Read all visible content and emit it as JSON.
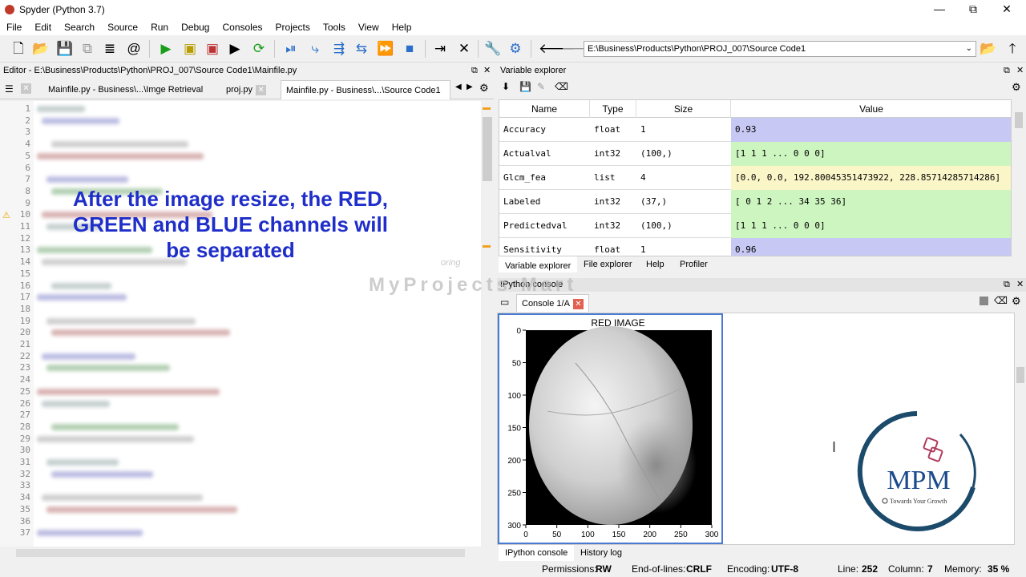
{
  "window": {
    "title": "Spyder (Python 3.7)",
    "minimize": "—",
    "maximize": "⧉",
    "close": "✕"
  },
  "menu": [
    "File",
    "Edit",
    "Search",
    "Source",
    "Run",
    "Debug",
    "Consoles",
    "Projects",
    "Tools",
    "View",
    "Help"
  ],
  "toolbar": {
    "path": "E:\\Business\\Products\\Python\\PROJ_007\\Source Code1"
  },
  "editor": {
    "title": "Editor - E:\\Business\\Products\\Python\\PROJ_007\\Source Code1\\Mainfile.py",
    "tabs": [
      {
        "label": "Mainfile.py - Business\\...\\Imge Retrieval"
      },
      {
        "label": "proj.py"
      },
      {
        "label": "Mainfile.py - Business\\...\\Source Code1"
      }
    ],
    "line_numbers": [
      "1",
      "2",
      "3",
      "4",
      "5",
      "6",
      "7",
      "8",
      "9",
      "10",
      "11",
      "12",
      "13",
      "14",
      "15",
      "16",
      "17",
      "18",
      "19",
      "20",
      "21",
      "22",
      "23",
      "24",
      "25",
      "26",
      "27",
      "28",
      "29",
      "30",
      "31",
      "32",
      "33",
      "34",
      "35",
      "36",
      "37"
    ],
    "faint_code": "oring"
  },
  "overlay": {
    "line1": "After the image resize, the RED,",
    "line2": "GREEN and BLUE channels will",
    "line3": "be separated"
  },
  "variable_explorer": {
    "title": "Variable explorer",
    "headers": {
      "name": "Name",
      "type": "Type",
      "size": "Size",
      "value": "Value"
    },
    "rows": [
      {
        "name": "Accuracy",
        "type": "float",
        "size": "1",
        "value": "0.93",
        "color": "#c8c8f5"
      },
      {
        "name": "Actualval",
        "type": "int32",
        "size": "(100,)",
        "value": "[1 1 1 ... 0 0 0]",
        "color": "#cdf5c0"
      },
      {
        "name": "Glcm_fea",
        "type": "list",
        "size": "4",
        "value": "[0.0, 0.0, 192.80045351473922, 228.85714285714286]",
        "color": "#fbf6c8"
      },
      {
        "name": "Labeled",
        "type": "int32",
        "size": "(37,)",
        "value": "[ 0  1  2 ... 34 35 36]",
        "color": "#cdf5c0"
      },
      {
        "name": "Predictedval",
        "type": "int32",
        "size": "(100,)",
        "value": "[1 1 1 ... 0 0 0]",
        "color": "#cdf5c0"
      },
      {
        "name": "Sensitivity",
        "type": "float",
        "size": "1",
        "value": "0.96",
        "color": "#c8c8f5"
      }
    ],
    "tabs": [
      "Variable explorer",
      "File explorer",
      "Help",
      "Profiler"
    ]
  },
  "ipython": {
    "title": "IPython console",
    "console_tab": "Console 1/A",
    "bottom_tabs": [
      "IPython console",
      "History log"
    ],
    "plot": {
      "title": "RED IMAGE",
      "yticks": [
        "0",
        "50",
        "100",
        "150",
        "200",
        "250",
        "300"
      ],
      "xticks": [
        "0",
        "50",
        "100",
        "150",
        "200",
        "250",
        "300"
      ]
    }
  },
  "watermark": "MyProjects Mart",
  "logo": {
    "text": "MPM",
    "tagline": "Towards Your Growth"
  },
  "status": {
    "permissions_label": "Permissions:",
    "permissions": "RW",
    "eol_label": "End-of-lines:",
    "eol": "CRLF",
    "encoding_label": "Encoding:",
    "encoding": "UTF-8",
    "line_label": "Line:",
    "line": "252",
    "column_label": "Column:",
    "column": "7",
    "memory_label": "Memory:",
    "memory": "35 %"
  }
}
